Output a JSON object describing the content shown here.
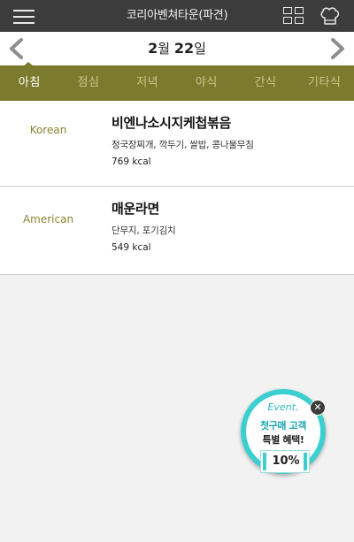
{
  "header": {
    "title": "코리아벤쳐타운(파견)"
  },
  "date": {
    "month": "2",
    "month_unit": "월",
    "day": "22",
    "day_unit": "일"
  },
  "tabs": [
    {
      "label": "아침",
      "active": true
    },
    {
      "label": "점심"
    },
    {
      "label": "저녁"
    },
    {
      "label": "야식"
    },
    {
      "label": "간식"
    },
    {
      "label": "기타식"
    }
  ],
  "meals": [
    {
      "cuisine": "Korean",
      "name": "비엔나소시지케첩볶음",
      "sides": "청국장찌개, 깍두기, 쌀밥, 콩나물무침",
      "kcal": "769 kcal"
    },
    {
      "cuisine": "American",
      "name": "매운라면",
      "sides": "단무지, 포기김치",
      "kcal": "549 kcal"
    }
  ],
  "event": {
    "tag": "Event.",
    "line1": "첫구매 고객",
    "line2": "특별 혜택!",
    "percent": "10%"
  },
  "colors": {
    "accent": "#7c7b2d",
    "header": "#3c3c3c",
    "event": "#3ccfcf"
  }
}
